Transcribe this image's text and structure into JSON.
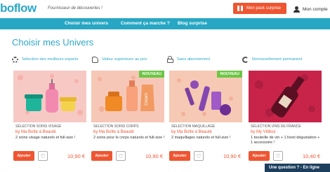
{
  "header": {
    "logo_text": "boflow",
    "tagline": "Fournisseur de découvertes !",
    "surprise_button": "Mon pack surprise",
    "account_label": "Mon compte"
  },
  "nav": {
    "items": [
      {
        "label": "Choisir mes univers"
      },
      {
        "label": "Comment ça marche ?"
      },
      {
        "label": "Blog surprise"
      }
    ]
  },
  "page": {
    "title": "Choisir mes Univers"
  },
  "features": [
    {
      "label": "Sélection des meilleurs experts",
      "icon": "gear-icon"
    },
    {
      "label": "Valeur supérieure au prix",
      "icon": "thumbs-up-icon"
    },
    {
      "label": "Sans abonnement",
      "icon": "lock-icon"
    },
    {
      "label": "Renouvellement permanent",
      "icon": "refresh-icon"
    }
  ],
  "products": [
    {
      "category": "SÉLECTION SOINS VISAGE",
      "by": "by Ma Boîte à Beauté",
      "desc": "2 soins visage naturels et full-size !",
      "price": "10,90 €",
      "add": "Ajouter",
      "badge": ""
    },
    {
      "category": "SÉLECTION SOINS CORPS",
      "by": "by Ma Boîte à Beauté",
      "desc": "2 soins pour le corps naturels et full-size !",
      "price": "10,90 €",
      "add": "Ajouter",
      "badge": "NOUVEAU",
      "tube_text": "Cream"
    },
    {
      "category": "SÉLECTION MAQUILLAGE",
      "by": "by Ma Boîte à Beauté",
      "desc": "2 maquillages naturels et full-size !",
      "price": "10,90 €",
      "add": "Ajouter",
      "badge": "NOUVEAU"
    },
    {
      "category": "SÉLECTION VINS DE FRANCE",
      "by": "by My Vitibox",
      "desc": "1 bouteille de vin + 1 livret dégustation + 1 accessoire !",
      "price": "10,40 €",
      "add": "Ajouter",
      "badge": ""
    }
  ],
  "chat": {
    "label": "Une question ? - En ligne"
  },
  "colors": {
    "accent": "#27a7c4",
    "cta": "#ee5531",
    "badge": "#6cc644"
  }
}
